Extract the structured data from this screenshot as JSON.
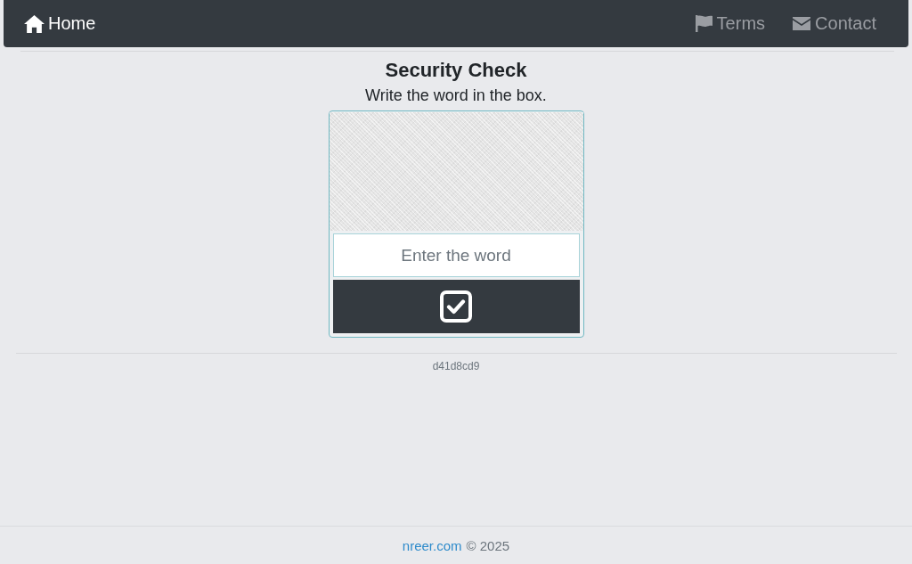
{
  "navbar": {
    "brand": {
      "label": "Home"
    },
    "links": [
      {
        "label": "Terms"
      },
      {
        "label": "Contact"
      }
    ]
  },
  "captcha": {
    "title": "Security Check",
    "instruction": "Write the word in the box.",
    "input": {
      "placeholder": "Enter the word"
    }
  },
  "hash": "d41d8cd9",
  "footer": {
    "link": "nreer.com",
    "text": "© 2025"
  }
}
